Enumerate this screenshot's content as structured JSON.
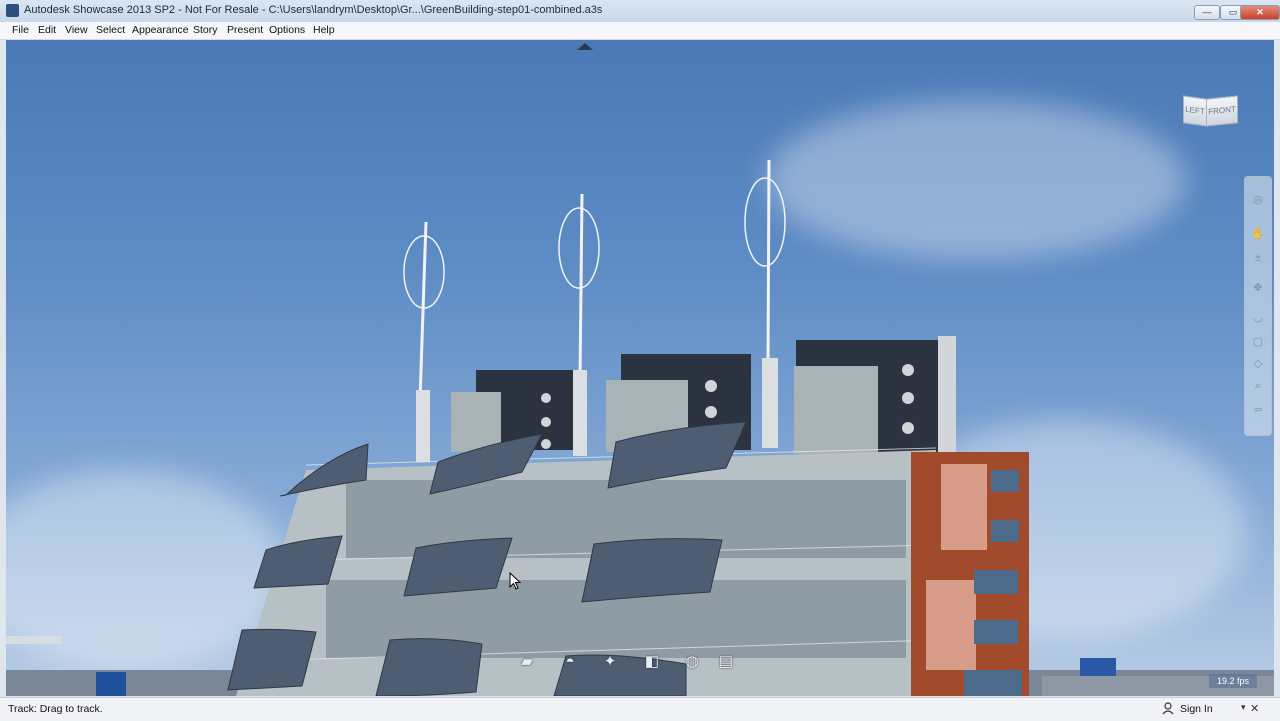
{
  "window": {
    "title": "Autodesk Showcase 2013 SP2 - Not For Resale - C:\\Users\\landrym\\Desktop\\Gr...\\GreenBuilding-step01-combined.a3s",
    "minimize_label": "—",
    "maximize_label": "▭",
    "close_label": "✕"
  },
  "menu": {
    "items": [
      "File",
      "Edit",
      "View",
      "Select",
      "Appearance",
      "Story",
      "Present",
      "Options",
      "Help"
    ]
  },
  "viewcube": {
    "left_label": "LEFT",
    "front_label": "FRONT"
  },
  "navbar": {
    "icons": [
      "steering-wheel-icon",
      "pan-icon",
      "zoom-icon",
      "orbit-icon",
      "look-icon",
      "walk-icon",
      "zoom-window-icon",
      "zoom-extents-icon",
      "back-icon"
    ]
  },
  "viewport": {
    "fps": "19.2 fps"
  },
  "toolstrip": {
    "icons": [
      "folder-icon",
      "environment-icon",
      "light-icon",
      "materials-icon",
      "sphere-icon",
      "document-icon"
    ]
  },
  "status": {
    "message": "Track: Drag to track.",
    "signin": "Sign In"
  },
  "colors": {
    "sky_top": "#4a79b6",
    "sky_bottom": "#b9cde6",
    "brick": "#a24a2c",
    "panel": "#2b3340"
  }
}
